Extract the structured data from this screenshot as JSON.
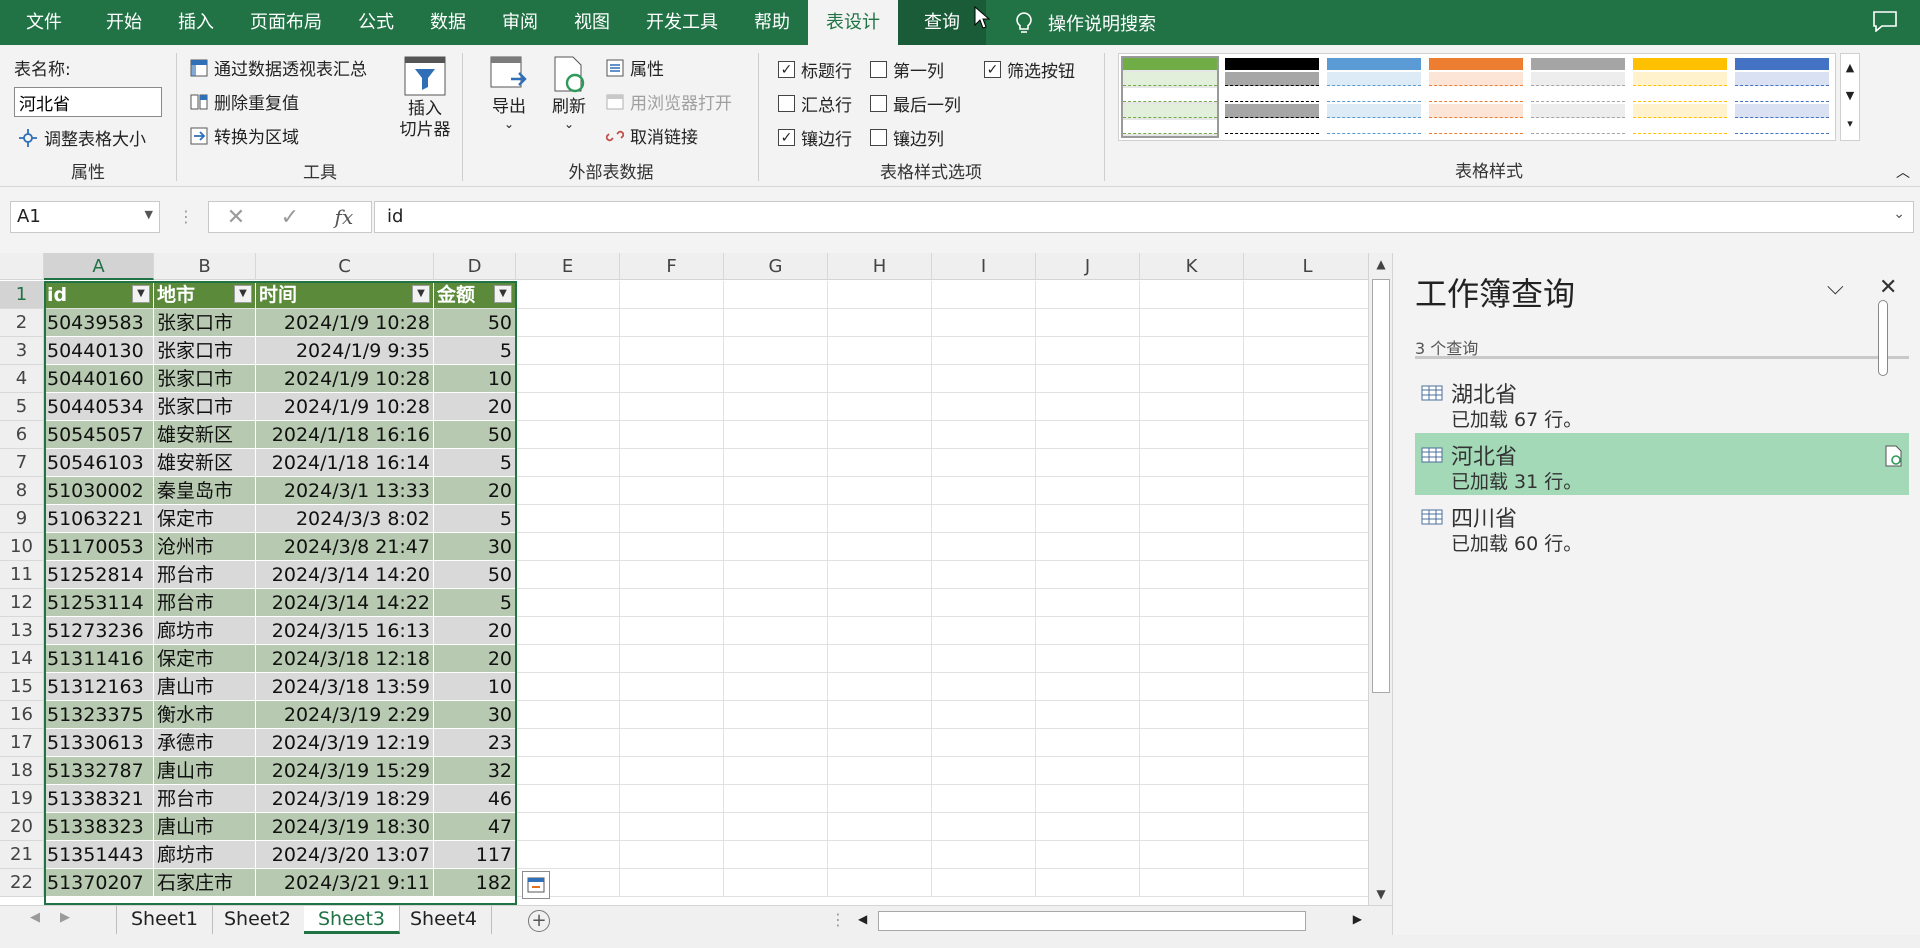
{
  "menu": {
    "items": [
      "文件",
      "开始",
      "插入",
      "页面布局",
      "公式",
      "数据",
      "审阅",
      "视图",
      "开发工具",
      "帮助",
      "表设计",
      "查询"
    ],
    "active_index": 10,
    "tell_me": "操作说明搜索"
  },
  "ribbon": {
    "properties": {
      "table_name_label": "表名称:",
      "table_name_value": "河北省",
      "resize_table": "调整表格大小",
      "group_label": "属性"
    },
    "tools": {
      "summarize_pivot": "通过数据透视表汇总",
      "remove_duplicates": "删除重复值",
      "convert_to_range": "转换为区域",
      "insert_slicer_line1": "插入",
      "insert_slicer_line2": "切片器",
      "group_label": "工具"
    },
    "external": {
      "export": "导出",
      "refresh": "刷新",
      "properties": "属性",
      "open_in_browser": "用浏览器打开",
      "unlink": "取消链接",
      "group_label": "外部表数据"
    },
    "style_options": {
      "header_row": "标题行",
      "total_row": "汇总行",
      "banded_rows": "镶边行",
      "first_column": "第一列",
      "last_column": "最后一列",
      "banded_columns": "镶边列",
      "filter_button": "筛选按钮",
      "header_row_checked": true,
      "total_row_checked": false,
      "banded_rows_checked": true,
      "first_column_checked": false,
      "last_column_checked": false,
      "banded_columns_checked": false,
      "filter_button_checked": true,
      "group_label": "表格样式选项"
    },
    "table_styles": {
      "group_label": "表格样式",
      "swatch_colors": [
        {
          "header": "#70ad47",
          "band": "#e2efda",
          "selected": true
        },
        {
          "header": "#000000",
          "band": "#a6a6a6",
          "selected": false
        },
        {
          "header": "#5b9bd5",
          "band": "#ddebf7",
          "selected": false
        },
        {
          "header": "#ed7d31",
          "band": "#fce4d6",
          "selected": false
        },
        {
          "header": "#a5a5a5",
          "band": "#ededed",
          "selected": false
        },
        {
          "header": "#ffc000",
          "band": "#fff2cc",
          "selected": false
        },
        {
          "header": "#4472c4",
          "band": "#d9e1f2",
          "selected": false
        }
      ]
    }
  },
  "formula_bar": {
    "name_box": "A1",
    "formula": "id"
  },
  "grid": {
    "columns": [
      "A",
      "B",
      "C",
      "D",
      "E",
      "F",
      "G",
      "H",
      "I",
      "J",
      "K",
      "L"
    ],
    "table_headers": [
      "id",
      "地市",
      "时间",
      "金额"
    ],
    "rows": [
      {
        "num": "1"
      },
      {
        "num": "2",
        "id": "50439583",
        "city": "张家口市",
        "time": "2024/1/9 10:28",
        "amount": "50"
      },
      {
        "num": "3",
        "id": "50440130",
        "city": "张家口市",
        "time": "2024/1/9 9:35",
        "amount": "5"
      },
      {
        "num": "4",
        "id": "50440160",
        "city": "张家口市",
        "time": "2024/1/9 10:28",
        "amount": "10"
      },
      {
        "num": "5",
        "id": "50440534",
        "city": "张家口市",
        "time": "2024/1/9 10:28",
        "amount": "20"
      },
      {
        "num": "6",
        "id": "50545057",
        "city": "雄安新区",
        "time": "2024/1/18 16:16",
        "amount": "50"
      },
      {
        "num": "7",
        "id": "50546103",
        "city": "雄安新区",
        "time": "2024/1/18 16:14",
        "amount": "5"
      },
      {
        "num": "8",
        "id": "51030002",
        "city": "秦皇岛市",
        "time": "2024/3/1 13:33",
        "amount": "20"
      },
      {
        "num": "9",
        "id": "51063221",
        "city": "保定市",
        "time": "2024/3/3 8:02",
        "amount": "5"
      },
      {
        "num": "10",
        "id": "51170053",
        "city": "沧州市",
        "time": "2024/3/8 21:47",
        "amount": "30"
      },
      {
        "num": "11",
        "id": "51252814",
        "city": "邢台市",
        "time": "2024/3/14 14:20",
        "amount": "50"
      },
      {
        "num": "12",
        "id": "51253114",
        "city": "邢台市",
        "time": "2024/3/14 14:22",
        "amount": "5"
      },
      {
        "num": "13",
        "id": "51273236",
        "city": "廊坊市",
        "time": "2024/3/15 16:13",
        "amount": "20"
      },
      {
        "num": "14",
        "id": "51311416",
        "city": "保定市",
        "time": "2024/3/18 12:18",
        "amount": "20"
      },
      {
        "num": "15",
        "id": "51312163",
        "city": "唐山市",
        "time": "2024/3/18 13:59",
        "amount": "10"
      },
      {
        "num": "16",
        "id": "51323375",
        "city": "衡水市",
        "time": "2024/3/19 2:29",
        "amount": "30"
      },
      {
        "num": "17",
        "id": "51330613",
        "city": "承德市",
        "time": "2024/3/19 12:19",
        "amount": "23"
      },
      {
        "num": "18",
        "id": "51332787",
        "city": "唐山市",
        "time": "2024/3/19 15:29",
        "amount": "32"
      },
      {
        "num": "19",
        "id": "51338321",
        "city": "邢台市",
        "time": "2024/3/19 18:29",
        "amount": "46"
      },
      {
        "num": "20",
        "id": "51338323",
        "city": "唐山市",
        "time": "2024/3/19 18:30",
        "amount": "47"
      },
      {
        "num": "21",
        "id": "51351443",
        "city": "廊坊市",
        "time": "2024/3/20 13:07",
        "amount": "117"
      },
      {
        "num": "22",
        "id": "51370207",
        "city": "石家庄市",
        "time": "2024/3/21 9:11",
        "amount": "182"
      }
    ]
  },
  "sheets": {
    "tabs": [
      "Sheet1",
      "Sheet2",
      "Sheet3",
      "Sheet4"
    ],
    "active_index": 2
  },
  "queries_pane": {
    "title": "工作簿查询",
    "count_label": "3 个查询",
    "queries": [
      {
        "name": "湖北省",
        "status": "已加载 67 行。",
        "selected": false
      },
      {
        "name": "河北省",
        "status": "已加载 31 行。",
        "selected": true
      },
      {
        "name": "四川省",
        "status": "已加载 60 行。",
        "selected": false
      }
    ]
  },
  "colors": {
    "accent": "#217346",
    "table_header": "#5a8a3a",
    "band_odd": "#b7c9b0",
    "band_even": "#d9d9d9",
    "selected_query": "#a3d9b7"
  }
}
